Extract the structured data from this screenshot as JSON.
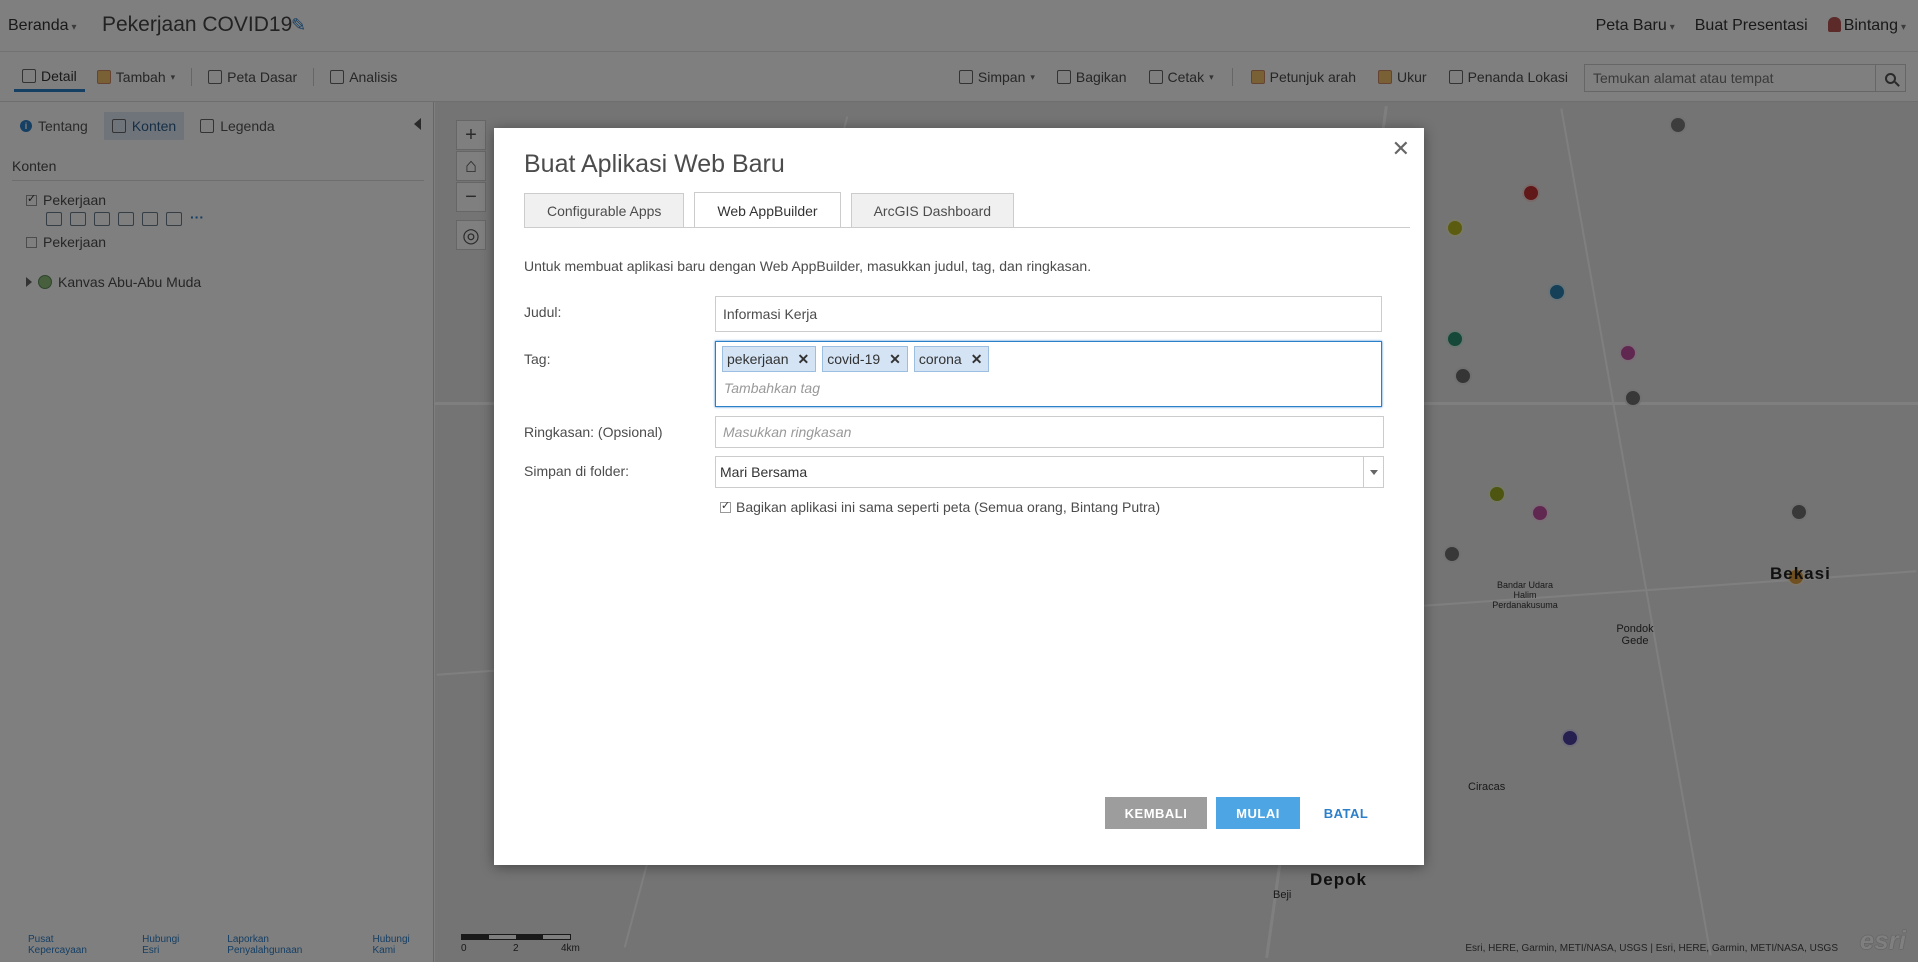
{
  "header": {
    "home_label": "Beranda",
    "map_title": "Pekerjaan COVID19",
    "new_map": "Peta Baru",
    "create_presentation": "Buat Presentasi",
    "user_name": "Bintang"
  },
  "toolbar": {
    "details": "Detail",
    "add": "Tambah",
    "basemap": "Peta Dasar",
    "analysis": "Analisis",
    "save": "Simpan",
    "share": "Bagikan",
    "print": "Cetak",
    "directions": "Petunjuk arah",
    "measure": "Ukur",
    "location_marker": "Penanda Lokasi",
    "search_placeholder": "Temukan alamat atau tempat"
  },
  "left_panel": {
    "tabs": [
      "Tentang",
      "Konten",
      "Legenda"
    ],
    "heading": "Konten",
    "layers": [
      {
        "name": "Pekerjaan",
        "checked": true
      },
      {
        "name": "Pekerjaan",
        "checked": false
      }
    ],
    "basemap_name": "Kanvas Abu-Abu Muda",
    "footer_links": [
      "Pusat Kepercayaan",
      "Hubungi Esri",
      "Laporkan Penyalahgunaan",
      "Hubungi Kami"
    ]
  },
  "map": {
    "labels": {
      "bekasi": "Bekasi",
      "depok": "Depok",
      "bandar_udara": "Bandar Udara Halim Perdanakusuma",
      "pondok_gede": "Pondok Gede",
      "ciracas": "Ciracas",
      "beji": "Beji"
    },
    "scale_labels": [
      "0",
      "2",
      "4km"
    ],
    "attribution": "Esri, HERE, Garmin, METI/NASA, USGS | Esri, HERE, Garmin, METI/NASA, USGS",
    "logo_text": "esri",
    "dot_colors": [
      "#7a7a7a",
      "#b8b820",
      "#c03030",
      "#2a80b0",
      "#2a9070",
      "#c050a0",
      "#707070",
      "#6a6a6a",
      "#9aaa20",
      "#c050a0",
      "#707070",
      "#e0a040",
      "#4a40a0",
      "#707070"
    ]
  },
  "dialog": {
    "title": "Buat Aplikasi Web Baru",
    "tabs": [
      "Configurable Apps",
      "Web AppBuilder",
      "ArcGIS Dashboard"
    ],
    "description": "Untuk membuat aplikasi baru dengan Web AppBuilder, masukkan judul, tag, dan ringkasan.",
    "title_label": "Judul:",
    "title_value": "Informasi Kerja",
    "tag_label": "Tag:",
    "tags": [
      "pekerjaan",
      "covid-19",
      "corona"
    ],
    "tag_placeholder": "Tambahkan tag",
    "summary_label": "Ringkasan: (Opsional)",
    "summary_placeholder": "Masukkan ringkasan",
    "folder_label": "Simpan di folder:",
    "folder_value": "Mari Bersama",
    "share_text": "Bagikan aplikasi ini sama seperti peta (Semua orang, Bintang Putra)",
    "share_checked": true,
    "back_button": "KEMBALI",
    "start_button": "MULAI",
    "cancel_button": "BATAL"
  }
}
